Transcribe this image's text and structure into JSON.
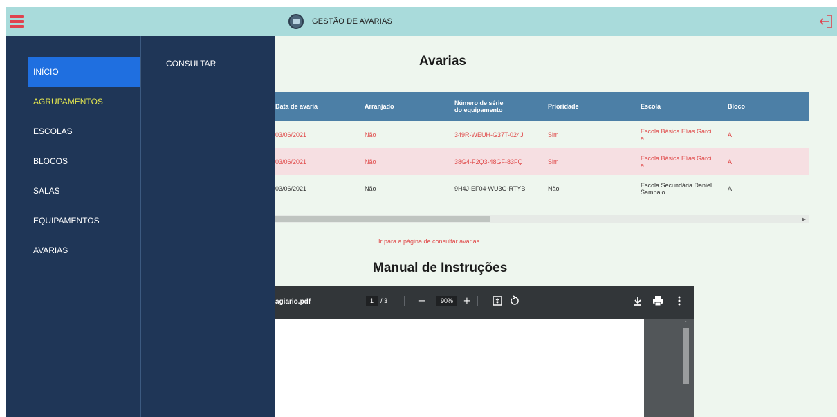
{
  "header": {
    "title": "GESTÃO DE AVARIAS",
    "menu_icon": "hamburger-menu-icon",
    "logout_icon": "logout-icon"
  },
  "sidebar": {
    "items": [
      {
        "label": "INÍCIO",
        "active": true
      },
      {
        "label": "AGRUPAMENTOS",
        "highlight": true
      },
      {
        "label": "ESCOLAS"
      },
      {
        "label": "BLOCOS"
      },
      {
        "label": "SALAS"
      },
      {
        "label": "EQUIPAMENTOS"
      },
      {
        "label": "AVARIAS"
      }
    ]
  },
  "submenu": {
    "items": [
      "CONSULTAR"
    ]
  },
  "main": {
    "title": "Avarias",
    "table": {
      "headers": [
        "Data de avaria",
        "Arranjado",
        "Número de série\ndo equipamento",
        "Prioridade",
        "Escola",
        "Bloco"
      ],
      "rows": [
        {
          "data": "03/06/2021",
          "arranjado": "Não",
          "serie": "349R-WEUH-G37T-024J",
          "prioridade": "Sim",
          "escola": "Escola Básica Elias Garci\na",
          "bloco": "A"
        },
        {
          "data": "03/06/2021",
          "arranjado": "Não",
          "serie": "38G4-F2Q3-48GF-83FQ",
          "prioridade": "Sim",
          "escola": "Escola Básica Elias Garci\na",
          "bloco": "A"
        },
        {
          "data": "03/06/2021",
          "arranjado": "Não",
          "serie": "9H4J-EF04-WU3G-RTYB",
          "prioridade": "Não",
          "escola": "Escola Secundária Daniel\nSampaio",
          "bloco": "A"
        }
      ]
    },
    "link": "Ir para a página de consultar avarias",
    "manual_title": "Manual de Instruções"
  },
  "pdf_viewer": {
    "filename": "agiario.pdf",
    "page_current": "1",
    "page_total": "/ 3",
    "zoom": "90%"
  },
  "colors": {
    "topbar": "#a9dbdb",
    "sidebar": "#1f3657",
    "active": "#1f6fe0",
    "accent_red": "#e04a4a",
    "table_header": "#4c7fa6",
    "row_highlight": "#f6dfe2"
  }
}
